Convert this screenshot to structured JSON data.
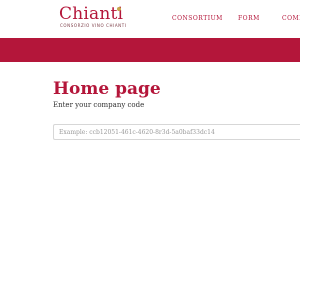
{
  "brand": {
    "name": "Chianti",
    "tagline": "CONSORZIO VINO CHIANTI",
    "accent_color": "#b4163a",
    "logo_mark_color": "#c8a64a"
  },
  "nav": {
    "items": [
      {
        "label": "CONSORTIUM"
      },
      {
        "label": "FORM"
      },
      {
        "label": "COMP"
      }
    ]
  },
  "main": {
    "title": "Home page",
    "company_code": {
      "label": "Enter your company code",
      "value": "",
      "placeholder": "Example: ccb12051-461c-4620-8r3d-5a0baf33dc14"
    }
  }
}
